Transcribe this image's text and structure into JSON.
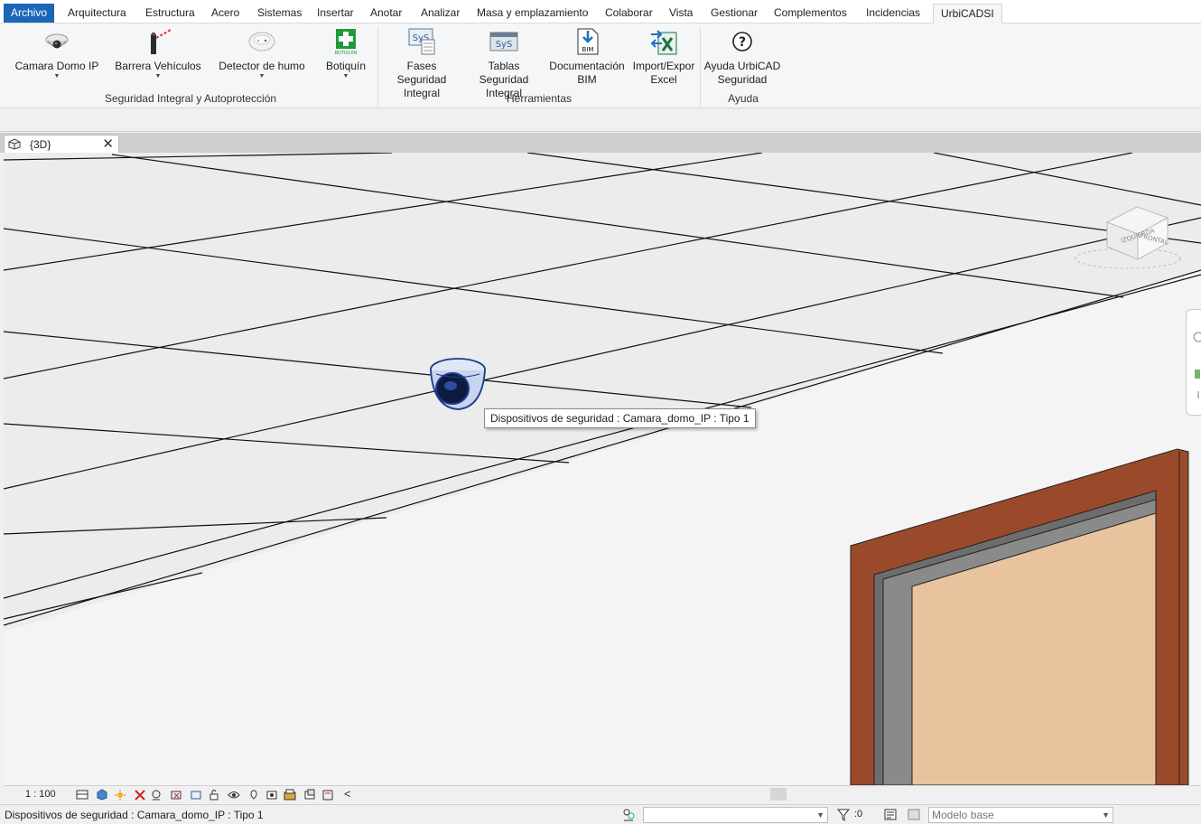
{
  "menu": {
    "items": [
      "Archivo",
      "Arquitectura",
      "Estructura",
      "Acero",
      "Sistemas",
      "Insertar",
      "Anotar",
      "Analizar",
      "Masa y emplazamiento",
      "Colaborar",
      "Vista",
      "Gestionar",
      "Complementos",
      "Incidencias",
      "UrbiCADSI"
    ],
    "active": "UrbiCADSI"
  },
  "ribbon": {
    "buttons": [
      {
        "line1": "Camara Domo IP",
        "line2": "",
        "icon": "dome-camera-icon",
        "dropdown": true
      },
      {
        "line1": "Barrera Vehículos",
        "line2": "",
        "icon": "vehicle-barrier-icon",
        "dropdown": true
      },
      {
        "line1": "Detector de humo",
        "line2": "",
        "icon": "smoke-detector-icon",
        "dropdown": true
      },
      {
        "line1": "Botiquín",
        "line2": "",
        "icon": "first-aid-kit-icon",
        "dropdown": true
      },
      {
        "line1": "Fases Seguridad",
        "line2": "Integral",
        "icon": "phases-icon",
        "dropdown": false
      },
      {
        "line1": "Tablas Seguridad",
        "line2": "Integral",
        "icon": "tables-icon",
        "dropdown": false
      },
      {
        "line1": "Documentación",
        "line2": "BIM",
        "icon": "bim-document-icon",
        "dropdown": false
      },
      {
        "line1": "Import/Expor",
        "line2": "Excel",
        "icon": "excel-import-export-icon",
        "dropdown": false
      },
      {
        "line1": "Ayuda UrbiCAD",
        "line2": "Seguridad",
        "icon": "help-icon",
        "dropdown": false
      }
    ],
    "panels": [
      "Seguridad Integral y Autoprotección",
      "Herramientas",
      "Ayuda"
    ],
    "first_aid_caption": "BOTIQUÍN",
    "sys_text": "SyS",
    "bim_text": "BIM"
  },
  "view_tab": {
    "label": "{3D}",
    "close": "✕"
  },
  "viewport": {
    "tooltip": "Dispositivos de seguridad : Camara_domo_IP : Tipo 1",
    "viewcube_left": "IZQUIERDA",
    "viewcube_front": "FRONTAL",
    "door_frame_color": "#9a4a2a",
    "door_panel_color": "#e8c39e"
  },
  "view_control": {
    "scale": "1 : 100",
    "arrow": "<"
  },
  "status_bar": {
    "text": "Dispositivos de seguridad : Camara_domo_IP : Tipo 1",
    "selection_count": ":0",
    "model": "Modelo base"
  },
  "colors": {
    "file_tab": "#1d65b8",
    "camera_blue": "#1a3a8c"
  }
}
